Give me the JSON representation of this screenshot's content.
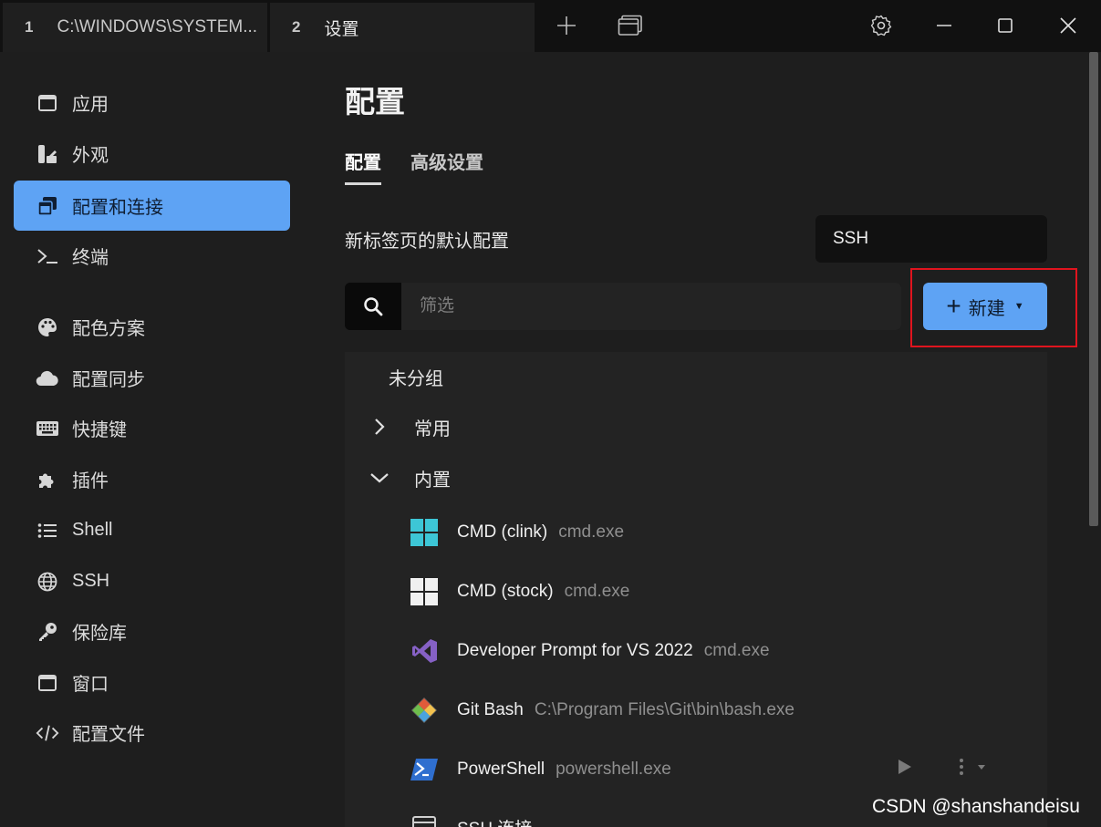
{
  "titlebar": {
    "tabs": [
      {
        "number": "1",
        "title": "C:\\WINDOWS\\SYSTEM..."
      },
      {
        "number": "2",
        "title": "设置"
      }
    ]
  },
  "sidebar": {
    "items": [
      {
        "label": "应用",
        "icon": "window-icon"
      },
      {
        "label": "外观",
        "icon": "palette-brush-icon"
      },
      {
        "label": "配置和连接",
        "icon": "window-stack-icon",
        "active": true
      },
      {
        "label": "终端",
        "icon": "terminal-icon"
      },
      {
        "label": "配色方案",
        "icon": "palette-icon"
      },
      {
        "label": "配置同步",
        "icon": "cloud-icon"
      },
      {
        "label": "快捷键",
        "icon": "keyboard-icon"
      },
      {
        "label": "插件",
        "icon": "puzzle-icon"
      },
      {
        "label": "Shell",
        "icon": "list-icon"
      },
      {
        "label": "SSH",
        "icon": "globe-icon"
      },
      {
        "label": "保险库",
        "icon": "key-icon"
      },
      {
        "label": "窗口",
        "icon": "window-icon"
      },
      {
        "label": "配置文件",
        "icon": "code-icon"
      }
    ]
  },
  "main": {
    "title": "配置",
    "tabs": [
      "配置",
      "高级设置"
    ],
    "default_profile_label": "新标签页的默认配置",
    "default_profile_value": "SSH",
    "search_placeholder": "筛选",
    "new_button_label": "新建",
    "group_ungrouped": "未分组",
    "groups": [
      {
        "label": "常用",
        "expanded": false
      },
      {
        "label": "内置",
        "expanded": true
      }
    ],
    "profiles": [
      {
        "name": "CMD (clink)",
        "command": "cmd.exe",
        "icon": "windows-clink-icon",
        "color": "#3dc6d6"
      },
      {
        "name": "CMD (stock)",
        "command": "cmd.exe",
        "icon": "windows-icon",
        "color": "#f0f0f0"
      },
      {
        "name": "Developer Prompt for VS 2022",
        "command": "cmd.exe",
        "icon": "visual-studio-icon",
        "color": "#8661c5"
      },
      {
        "name": "Git Bash",
        "command": "C:\\Program Files\\Git\\bin\\bash.exe",
        "icon": "git-icon",
        "color": "#e05a3a"
      },
      {
        "name": "PowerShell",
        "command": "powershell.exe",
        "icon": "powershell-icon",
        "color": "#2f6fcf"
      },
      {
        "name": "SSH 连接",
        "command": "",
        "icon": "window-icon",
        "color": "#cfcfcf"
      }
    ]
  },
  "watermark": "CSDN @shanshandeisu",
  "colors": {
    "accent": "#5ea3f4",
    "highlight_box": "#e0141e",
    "background": "#1e1e1e"
  }
}
